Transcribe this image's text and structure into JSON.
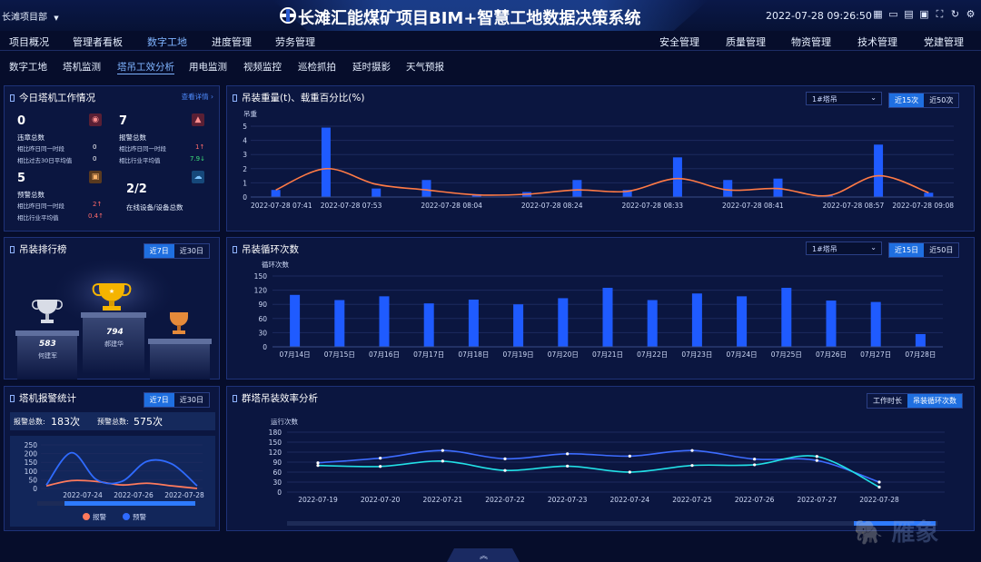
{
  "header": {
    "project": "长滩项目部",
    "title": "长滩汇能煤矿项目BIM+智慧工地数据决策系统",
    "datetime": "2022-07-28 09:26:50"
  },
  "nav_left": [
    {
      "label": "项目概况",
      "active": false
    },
    {
      "label": "管理者看板",
      "active": false
    },
    {
      "label": "数字工地",
      "active": true
    },
    {
      "label": "进度管理",
      "active": false
    },
    {
      "label": "劳务管理",
      "active": false
    }
  ],
  "nav_right": [
    {
      "label": "安全管理"
    },
    {
      "label": "质量管理"
    },
    {
      "label": "物资管理"
    },
    {
      "label": "技术管理"
    },
    {
      "label": "党建管理"
    }
  ],
  "subnav": [
    {
      "label": "数字工地",
      "active": false
    },
    {
      "label": "塔机监测",
      "active": false
    },
    {
      "label": "塔吊工效分析",
      "active": true
    },
    {
      "label": "用电监测",
      "active": false
    },
    {
      "label": "视频监控",
      "active": false
    },
    {
      "label": "巡检抓拍",
      "active": false
    },
    {
      "label": "延时摄影",
      "active": false
    },
    {
      "label": "天气预报",
      "active": false
    }
  ],
  "today_panel": {
    "title": "今日塔机工作情况",
    "more": "查看详情 ›",
    "violations": {
      "value": "0",
      "label": "违章总数",
      "rows": [
        {
          "k": "相比昨日同一时段",
          "v": "0"
        },
        {
          "k": "相比过去30日平均值",
          "v": "0"
        }
      ]
    },
    "alarms": {
      "value": "7",
      "label": "报警总数",
      "rows": [
        {
          "k": "相比昨日同一时段",
          "v": "1↑"
        },
        {
          "k": "相比行业平均值",
          "v": "7.9↓"
        }
      ]
    },
    "warnings": {
      "value": "5",
      "label": "预警总数",
      "rows": [
        {
          "k": "相比昨日同一时段",
          "v": "2↑"
        },
        {
          "k": "相比行业平均值",
          "v": "0.4↑"
        }
      ]
    },
    "online": {
      "value": "2/2",
      "label": "在线设备/设备总数"
    }
  },
  "ranking_panel": {
    "title": "吊装排行榜",
    "toggle": [
      "近7日",
      "近30日"
    ],
    "first": {
      "value": "794",
      "name": "郝建华"
    },
    "second": {
      "value": "583",
      "name": "何建军"
    },
    "third": {
      "value": "",
      "name": ""
    }
  },
  "alarm_panel": {
    "title": "塔机报警统计",
    "toggle": [
      "近7日",
      "近30日"
    ],
    "alarm_total_label": "报警总数:",
    "alarm_total": "183次",
    "warn_total_label": "预警总数:",
    "warn_total": "575次",
    "legend": [
      "报警",
      "预警"
    ]
  },
  "weight_panel": {
    "title": "吊装重量(t)、载重百分比(%)",
    "dropdown": "1#塔吊",
    "toggle": [
      "近15次",
      "近50次"
    ]
  },
  "cycle_panel": {
    "title": "吊装循环次数",
    "dropdown": "1#塔吊",
    "toggle": [
      "近15日",
      "近50日"
    ]
  },
  "group_panel": {
    "title": "群塔吊装效率分析",
    "toggle": [
      "工作时长",
      "吊装循环次数"
    ]
  },
  "chart_data": [
    {
      "type": "bar",
      "ylabel": "吊重",
      "ylim": [
        0,
        5
      ],
      "yticks": [
        0,
        1,
        2,
        3,
        4,
        5
      ],
      "x_tick_labels": [
        "2022-07-28 07:41",
        "2022-07-28 07:53",
        "2022-07-28 08:04",
        "2022-07-28 08:24",
        "2022-07-28 08:33",
        "2022-07-28 08:41",
        "2022-07-28 08:57",
        "2022-07-28 09:08"
      ],
      "bars": [
        0.5,
        4.9,
        0.6,
        1.2,
        0.2,
        0.35,
        1.2,
        0.5,
        2.8,
        1.2,
        1.3,
        0.1,
        3.7,
        0.3
      ],
      "line": [
        0.5,
        2.0,
        0.9,
        0.5,
        0.15,
        0.2,
        0.5,
        0.4,
        1.3,
        0.5,
        0.6,
        0.1,
        1.5,
        0.3
      ],
      "colors": {
        "bar": "#1f5bff",
        "line": "#ff7a45"
      }
    },
    {
      "type": "bar",
      "ylabel": "循环次数",
      "ylim": [
        0,
        150
      ],
      "yticks": [
        0,
        30,
        60,
        90,
        120,
        150
      ],
      "categories": [
        "07月14日",
        "07月15日",
        "07月16日",
        "07月17日",
        "07月18日",
        "07月19日",
        "07月20日",
        "07月21日",
        "07月22日",
        "07月23日",
        "07月24日",
        "07月25日",
        "07月26日",
        "07月27日",
        "07月28日"
      ],
      "values": [
        110,
        99,
        107,
        92,
        100,
        90,
        103,
        125,
        99,
        113,
        107,
        125,
        98,
        95,
        27
      ],
      "colors": {
        "bar": "#1f5bff"
      }
    },
    {
      "type": "line",
      "ylim": [
        0,
        250
      ],
      "yticks": [
        0,
        50,
        100,
        150,
        200,
        250
      ],
      "x_tick_labels": [
        "2022-07-24",
        "2022-07-26",
        "2022-07-28"
      ],
      "series": [
        {
          "name": "报警",
          "values": [
            15,
            45,
            40,
            20,
            30,
            15,
            0
          ],
          "color": "#ff7a5c"
        },
        {
          "name": "预警",
          "values": [
            20,
            205,
            50,
            40,
            155,
            140,
            15
          ],
          "color": "#2f6bff"
        }
      ]
    },
    {
      "type": "line",
      "ylabel": "运行次数",
      "ylim": [
        0,
        180
      ],
      "yticks": [
        0,
        30,
        60,
        90,
        120,
        150,
        180
      ],
      "categories": [
        "2022-07-19",
        "2022-07-20",
        "2022-07-21",
        "2022-07-22",
        "2022-07-23",
        "2022-07-24",
        "2022-07-25",
        "2022-07-26",
        "2022-07-27",
        "2022-07-28"
      ],
      "series": [
        {
          "values": [
            88,
            102,
            125,
            100,
            115,
            108,
            125,
            99,
            95,
            30
          ],
          "color": "#3d6cff"
        },
        {
          "values": [
            80,
            77,
            93,
            65,
            78,
            60,
            80,
            82,
            107,
            15
          ],
          "color": "#22e0e6"
        }
      ]
    }
  ]
}
